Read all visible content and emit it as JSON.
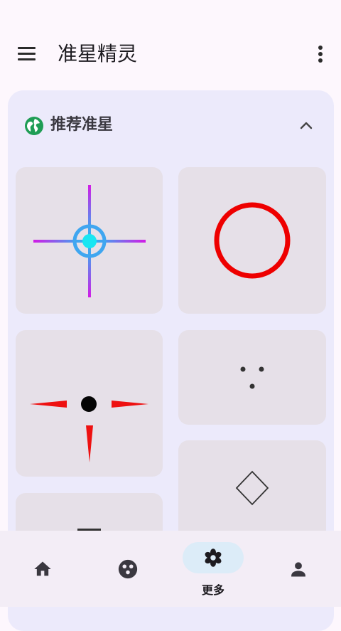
{
  "appbar": {
    "title": "准星精灵",
    "menu_icon": "hamburger-menu-icon",
    "overflow_icon": "more-vert-icon"
  },
  "section": {
    "title": "推荐准星",
    "icon": "globe-icon",
    "collapse_icon": "chevron-up-icon"
  },
  "crosshairs": [
    {
      "name": "blue-purple-cross-with-cyan-dot"
    },
    {
      "name": "red-circle"
    },
    {
      "name": "red-spikes-with-black-dot"
    },
    {
      "name": "three-dots"
    },
    {
      "name": "outline-diamond"
    },
    {
      "name": "dash-line"
    }
  ],
  "bottom_nav": {
    "items": [
      {
        "icon": "home-icon",
        "label": ""
      },
      {
        "icon": "palette-icon",
        "label": ""
      },
      {
        "icon": "flower-icon",
        "label": "更多",
        "active": true
      },
      {
        "icon": "person-icon",
        "label": ""
      }
    ]
  },
  "colors": {
    "background": "#fdf7fd",
    "panel": "#eceafb",
    "card": "#e6e0e8",
    "nav_bar": "#f3edf6",
    "active_pill": "#dcecf8",
    "globe_green": "#1f9d55"
  }
}
